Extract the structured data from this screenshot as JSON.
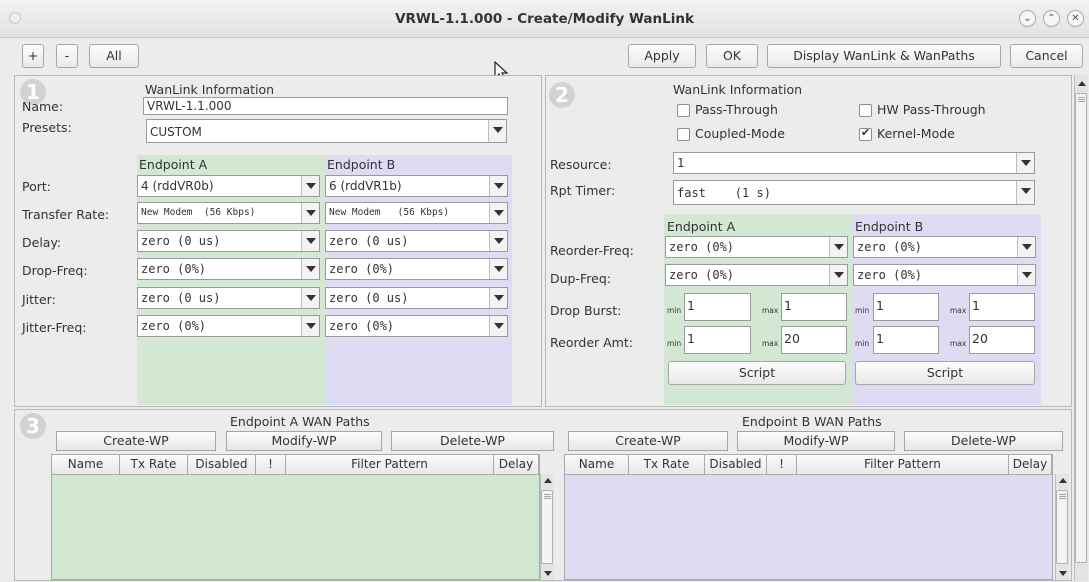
{
  "window": {
    "title": "VRWL-1.1.000 - Create/Modify WanLink",
    "controls": [
      "chevron-down-icon",
      "chevron-up-icon",
      "close-icon"
    ]
  },
  "toolbar": {
    "plus_label": "+",
    "minus_label": "-",
    "all_label": "All",
    "apply_label": "Apply",
    "ok_label": "OK",
    "display_label": "Display WanLink & WanPaths",
    "cancel_label": "Cancel"
  },
  "section1": {
    "badge": "1",
    "header": "WanLink Information",
    "name_label": "Name:",
    "name_value": "VRWL-1.1.000",
    "presets_label": "Presets:",
    "presets_value": "CUSTOM",
    "endpoint_a": "Endpoint A",
    "endpoint_b": "Endpoint B",
    "rows": [
      {
        "label": "Port:",
        "a": "4 (rddVR0b)",
        "b": "6 (rddVR1b)"
      },
      {
        "label": "Transfer Rate:",
        "a": "New Modem  (56 Kbps)",
        "b": "New Modem   (56 Kbps)"
      },
      {
        "label": "Delay:",
        "a": "zero (0 us)",
        "b": "zero (0 us)"
      },
      {
        "label": "Drop-Freq:",
        "a": "zero (0%)",
        "b": "zero (0%)"
      },
      {
        "label": "Jitter:",
        "a": "zero (0 us)",
        "b": "zero (0 us)"
      },
      {
        "label": "Jitter-Freq:",
        "a": "zero (0%)",
        "b": "zero (0%)"
      }
    ]
  },
  "section2": {
    "badge": "2",
    "header": "WanLink Information",
    "pass_through": "Pass-Through",
    "hw_pass_through": "HW Pass-Through",
    "coupled_mode": "Coupled-Mode",
    "kernel_mode": "Kernel-Mode",
    "kernel_mode_checked": true,
    "resource_label": "Resource:",
    "resource_value": "1",
    "rpt_label": "Rpt Timer:",
    "rpt_value": "fast    (1 s)",
    "endpoint_a": "Endpoint A",
    "endpoint_b": "Endpoint B",
    "reorder_freq_label": "Reorder-Freq:",
    "reorder_freq_a": "zero (0%)",
    "reorder_freq_b": "zero (0%)",
    "dup_freq_label": "Dup-Freq:",
    "dup_freq_a": "zero (0%)",
    "dup_freq_b": "zero (0%)",
    "drop_burst_label": "Drop Burst:",
    "reorder_amt_label": "Reorder Amt:",
    "min_label": "min",
    "max_label": "max",
    "drop_burst": {
      "a_min": "1",
      "a_max": "1",
      "b_min": "1",
      "b_max": "1"
    },
    "reorder_amt": {
      "a_min": "1",
      "a_max": "20",
      "b_min": "1",
      "b_max": "20"
    },
    "script_label": "Script"
  },
  "section3": {
    "badge": "3",
    "a_title": "Endpoint A WAN Paths",
    "b_title": "Endpoint B WAN Paths",
    "create_label": "Create-WP",
    "modify_label": "Modify-WP",
    "delete_label": "Delete-WP",
    "columns": [
      "Name",
      "Tx Rate",
      "Disabled",
      "!",
      "Filter Pattern",
      "Delay"
    ]
  },
  "colors": {
    "endpoint_a_bg": "#d3e8d3",
    "endpoint_b_bg": "#dedcf3",
    "window_bg": "#ececec"
  }
}
